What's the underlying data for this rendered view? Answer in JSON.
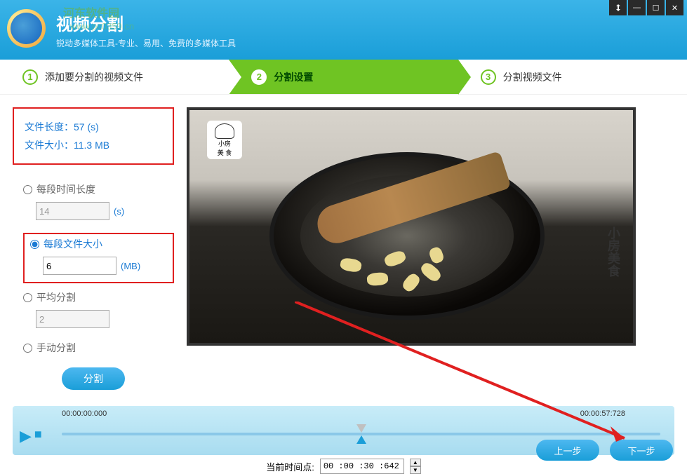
{
  "header": {
    "title": "视频分割",
    "subtitle": "锐动多媒体工具-专业、易用、免费的多媒体工具",
    "watermark_top": "河东软件园",
    "watermark_url": "www.pc0359.cn"
  },
  "window_controls": {
    "pin": "📌",
    "min": "—",
    "max": "☐",
    "close": "✕"
  },
  "steps": {
    "step1": {
      "num": "1",
      "label": "添加要分割的视频文件"
    },
    "step2": {
      "num": "2",
      "label": "分割设置"
    },
    "step3": {
      "num": "3",
      "label": "分割视频文件"
    }
  },
  "file_info": {
    "duration_label": "文件长度：",
    "duration_value": "57 (s)",
    "size_label": "文件大小：",
    "size_value": "11.3 MB"
  },
  "options": {
    "by_time": {
      "label": "每段时间长度",
      "value": "14",
      "unit": "(s)"
    },
    "by_size": {
      "label": "每段文件大小",
      "value": "6",
      "unit": "(MB)"
    },
    "average": {
      "label": "平均分割",
      "value": "2"
    },
    "manual": {
      "label": "手动分割"
    }
  },
  "split_button": "分割",
  "preview": {
    "chef_text": "小房",
    "chef_sub": "美 食",
    "side_text": "小房美食"
  },
  "timeline": {
    "start_time": "00:00:00:000",
    "end_time": "00:00:57:728",
    "current_label": "当前时间点:",
    "current_value": "00 :00 :30 :642"
  },
  "nav": {
    "prev": "上一步",
    "next": "下一步"
  }
}
